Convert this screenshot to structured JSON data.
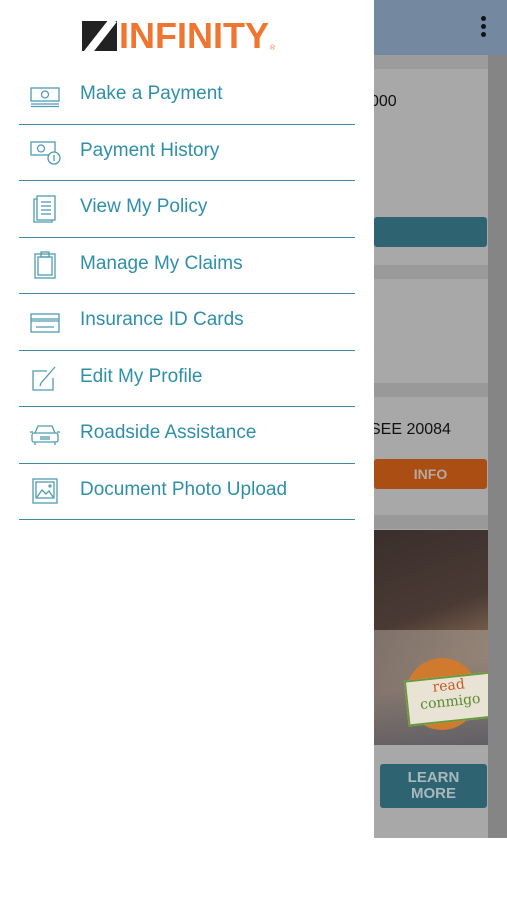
{
  "background_app": {
    "menu_icon": "kebab-vertical-icon",
    "card1_amount_fragment": "000",
    "card3_text_fragment": "SEE 20084",
    "info_button_label": "INFO",
    "promo_image_text": [
      "read",
      "conmigo"
    ],
    "learn_more_label": [
      "LEARN",
      "MORE"
    ],
    "colors": {
      "appbar": "#7489a0",
      "teal_button": "#2e6472",
      "orange_button": "#aa4e14"
    }
  },
  "drawer": {
    "logo_text": "INFINITY",
    "logo_registered": "®",
    "brand_color": "#f07530",
    "accent_color": "#2f8fab",
    "items": [
      {
        "label": "Make a Payment",
        "icon": "money-bill-icon"
      },
      {
        "label": "Payment History",
        "icon": "money-clock-icon"
      },
      {
        "label": "View My Policy",
        "icon": "document-icon"
      },
      {
        "label": "Manage My Claims",
        "icon": "clipboard-icon"
      },
      {
        "label": "Insurance ID Cards",
        "icon": "id-card-icon"
      },
      {
        "label": "Edit My Profile",
        "icon": "edit-pencil-icon"
      },
      {
        "label": "Roadside Assistance",
        "icon": "car-icon"
      },
      {
        "label": "Document Photo Upload",
        "icon": "image-upload-icon"
      }
    ]
  }
}
